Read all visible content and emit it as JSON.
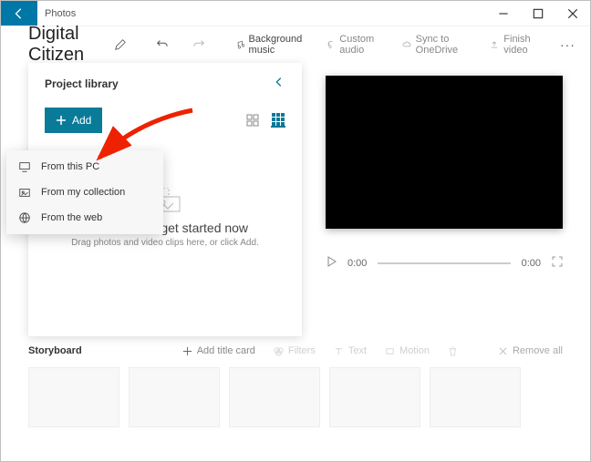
{
  "titlebar": {
    "app_name": "Photos"
  },
  "project": {
    "title": "Digital Citizen"
  },
  "toolbar": {
    "bg_music": "Background music",
    "custom_audio": "Custom audio",
    "sync": "Sync to OneDrive",
    "finish": "Finish video"
  },
  "library": {
    "title": "Project library",
    "add_label": "Add",
    "empty_title": "Add media to get started now",
    "empty_sub": "Drag photos and video clips here, or click Add."
  },
  "add_menu": {
    "from_pc": "From this PC",
    "from_collection": "From my collection",
    "from_web": "From the web"
  },
  "player": {
    "current": "0:00",
    "total": "0:00"
  },
  "storyboard": {
    "title": "Storyboard",
    "add_title_card": "Add title card",
    "filters": "Filters",
    "text": "Text",
    "motion": "Motion",
    "remove_all": "Remove all"
  }
}
